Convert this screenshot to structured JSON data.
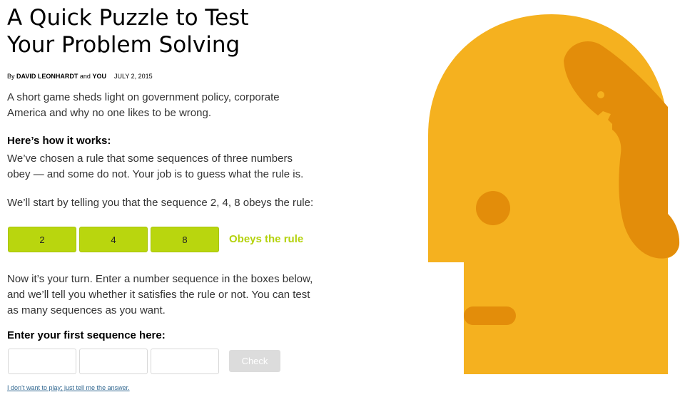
{
  "article": {
    "headline_lines": [
      "A Quick Puzzle to Test",
      "Your Problem Solving"
    ],
    "byline": {
      "prefix": "By",
      "author": "DAVID LEONHARDT",
      "conj": "and",
      "coauthor": "YOU",
      "date": "JULY 2, 2015"
    },
    "summary_lines": [
      "A short game sheds light on government policy, corporate",
      "America and why no one likes to be wrong."
    ],
    "how_heading": "Here’s how it works:",
    "rule_lines": [
      "We’ve chosen a rule that some sequences of three numbers",
      "obey — and some do not. Your job is to guess what the rule is."
    ],
    "start_line": "We’ll start by telling you that the sequence 2, 4, 8 obeys the rule:",
    "example": {
      "numbers": [
        "2",
        "4",
        "8"
      ],
      "result": "Obeys the rule"
    },
    "turn_lines": [
      "Now it’s your turn. Enter a number sequence in the boxes below,",
      "and we’ll tell you whether it satisfies the rule or not. You can test",
      "as many sequences as you want."
    ],
    "entry_heading": "Enter your first sequence here:",
    "inputs": [
      "",
      "",
      ""
    ],
    "check_label": "Check",
    "skip_link": "I don’t want to play; just tell me the answer."
  },
  "colors": {
    "green": "#b9d60e",
    "green_text": "#b4d20d",
    "head": "#f5b11f",
    "head_shadow": "#e38d0a",
    "link": "#326891"
  },
  "illustration": {
    "icon": "head-profile-illustration"
  }
}
